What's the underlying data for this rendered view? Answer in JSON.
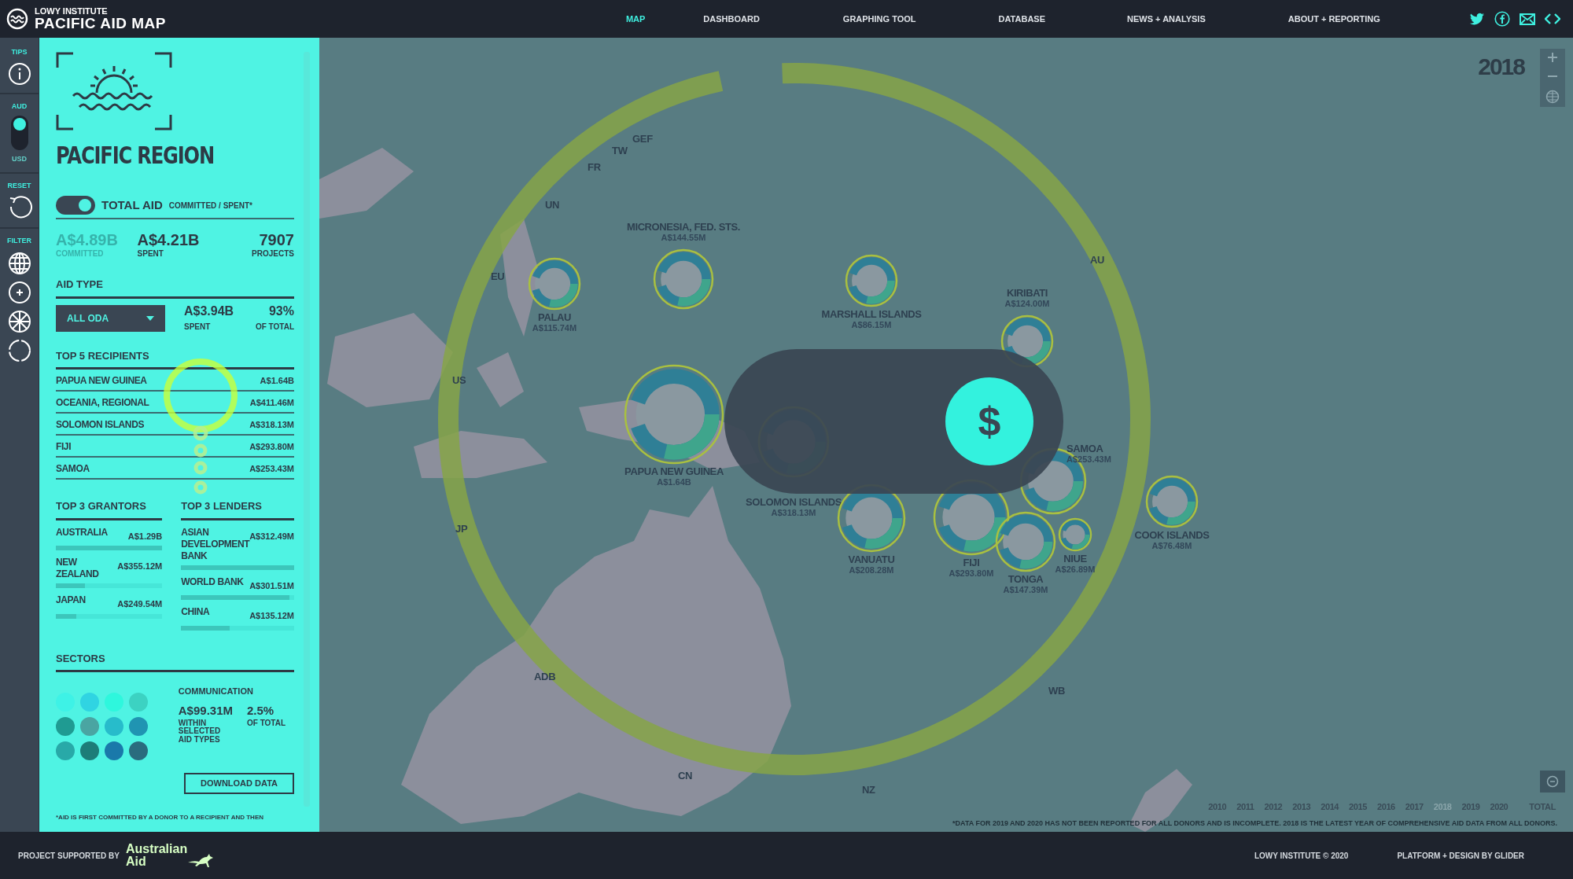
{
  "header": {
    "org": "LOWY INSTITUTE",
    "title": "PACIFIC AID MAP",
    "nav": [
      {
        "label": "MAP",
        "selected": true
      },
      {
        "label": "DASHBOARD",
        "selected": false
      },
      {
        "label": "GRAPHING TOOL",
        "selected": false
      },
      {
        "label": "DATABASE",
        "selected": false
      },
      {
        "label": "NEWS + ANALYSIS",
        "selected": false
      },
      {
        "label": "ABOUT + REPORTING",
        "selected": false
      }
    ]
  },
  "rail": {
    "tips_label": "TIPS",
    "currency": [
      {
        "label": "AUD",
        "selected": true
      },
      {
        "label": "USD",
        "selected": false
      }
    ],
    "reset_label": "RESET",
    "filter_label": "FILTER"
  },
  "panel": {
    "title": "PACIFIC REGION",
    "total_aid": {
      "on": true,
      "label": "TOTAL AID",
      "sublabel": "COMMITTED / SPENT*"
    },
    "stats": [
      {
        "value": "A$4.89B",
        "label": "COMMITTED",
        "dimmed": true
      },
      {
        "value": "A$4.21B",
        "label": "SPENT",
        "dimmed": false
      },
      {
        "value": "7907",
        "label": "PROJECTS",
        "dimmed": false
      }
    ],
    "aid_type": {
      "heading": "AID TYPE",
      "dropdown": "ALL ODA",
      "stats": [
        {
          "value": "A$3.94B",
          "label": "SPENT"
        },
        {
          "value": "93%",
          "label": "OF TOTAL"
        }
      ]
    },
    "top_recipients": {
      "heading": "TOP 5 RECIPIENTS",
      "rows": [
        {
          "name": "PAPUA NEW GUINEA",
          "value": "A$1.64B"
        },
        {
          "name": "OCEANIA, REGIONAL",
          "value": "A$411.46M"
        },
        {
          "name": "SOLOMON ISLANDS",
          "value": "A$318.13M"
        },
        {
          "name": "FIJI",
          "value": "A$293.80M"
        },
        {
          "name": "SAMOA",
          "value": "A$253.43M"
        }
      ]
    },
    "top_grantors": {
      "heading": "TOP 3 GRANTORS",
      "rows": [
        {
          "name": "AUSTRALIA",
          "value": "A$1.29B",
          "level": 1.0
        },
        {
          "name": "NEW ZEALAND",
          "value": "A$355.12M",
          "level": 0.27
        },
        {
          "name": "JAPAN",
          "value": "A$249.54M",
          "level": 0.19
        }
      ]
    },
    "top_lenders": {
      "heading": "TOP 3 LENDERS",
      "rows": [
        {
          "name": "ASIAN DEVELOPMENT BANK",
          "value": "A$312.49M",
          "level": 1.0
        },
        {
          "name": "WORLD BANK",
          "value": "A$301.51M",
          "level": 0.96
        },
        {
          "name": "CHINA",
          "value": "A$135.12M",
          "level": 0.43
        }
      ]
    },
    "sectors": {
      "heading": "SECTORS",
      "icons": [
        {
          "color": "#3ef2e6"
        },
        {
          "color": "#30d4e2"
        },
        {
          "color": "#2ef7dd"
        },
        {
          "color": "#3cd2c2"
        },
        {
          "color": "#1f9b92"
        },
        {
          "color": "#4aa5a2"
        },
        {
          "color": "#27bccb"
        },
        {
          "color": "#2094b2"
        },
        {
          "color": "#28a9a8"
        },
        {
          "color": "#1d7d78"
        },
        {
          "color": "#1a79aa"
        },
        {
          "color": "#2a6c7e"
        }
      ],
      "selected_name": "COMMUNICATION",
      "stats": [
        {
          "value": "A$99.31M",
          "label": "WITHIN SELECTED AID TYPES"
        },
        {
          "value": "2.5%",
          "label": "OF TOTAL"
        }
      ]
    },
    "download": "DOWNLOAD DATA",
    "footnote": "*AID IS FIRST COMMITTED BY A DONOR TO A RECIPIENT AND THEN"
  },
  "map": {
    "year": "2018",
    "donors": [
      "GEF",
      "TW",
      "FR",
      "UN",
      "EU",
      "US",
      "JP",
      "ADB",
      "CN",
      "NZ",
      "WB",
      "AU"
    ],
    "recipients": [
      {
        "name": "PALAU",
        "value": "A$115.74M"
      },
      {
        "name": "MICRONESIA, FED. STS.",
        "value": "A$144.55M"
      },
      {
        "name": "MARSHALL ISLANDS",
        "value": "A$86.15M"
      },
      {
        "name": "KIRIBATI",
        "value": "A$124.00M"
      },
      {
        "name": "PAPUA NEW GUINEA",
        "value": "A$1.64B"
      },
      {
        "name": "SOLOMON ISLANDS",
        "value": "A$318.13M"
      },
      {
        "name": "SAMOA",
        "value": "A$253.43M"
      },
      {
        "name": "VANUATU",
        "value": "A$208.28M"
      },
      {
        "name": "FIJI",
        "value": "A$293.80M"
      },
      {
        "name": "TONGA",
        "value": "A$147.39M"
      },
      {
        "name": "NIUE",
        "value": "A$26.89M"
      },
      {
        "name": "COOK ISLANDS",
        "value": "A$76.48M"
      }
    ],
    "currency_toggle": {
      "symbol": "$",
      "on": true
    },
    "years": [
      {
        "label": "2010",
        "selected": false
      },
      {
        "label": "2011",
        "selected": false
      },
      {
        "label": "2012",
        "selected": false
      },
      {
        "label": "2013",
        "selected": false
      },
      {
        "label": "2014",
        "selected": false
      },
      {
        "label": "2015",
        "selected": false
      },
      {
        "label": "2016",
        "selected": false
      },
      {
        "label": "2017",
        "selected": false
      },
      {
        "label": "2018",
        "selected": true
      },
      {
        "label": "2019",
        "selected": false
      },
      {
        "label": "2020",
        "selected": false
      },
      {
        "label": "TOTAL",
        "selected": false
      }
    ],
    "footnote": "*DATA FOR 2019 AND 2020 HAS NOT BEEN REPORTED FOR ALL DONORS AND IS INCOMPLETE. 2018 IS THE LATEST YEAR OF COMPREHENSIVE AID DATA FROM ALL DONORS."
  },
  "footer": {
    "supported_by": "PROJECT SUPPORTED BY",
    "partner_logo": [
      "Australian",
      "Aid"
    ],
    "copyright": "LOWY INSTITUTE © 2020",
    "credit": "PLATFORM + DESIGN BY GLIDER"
  }
}
